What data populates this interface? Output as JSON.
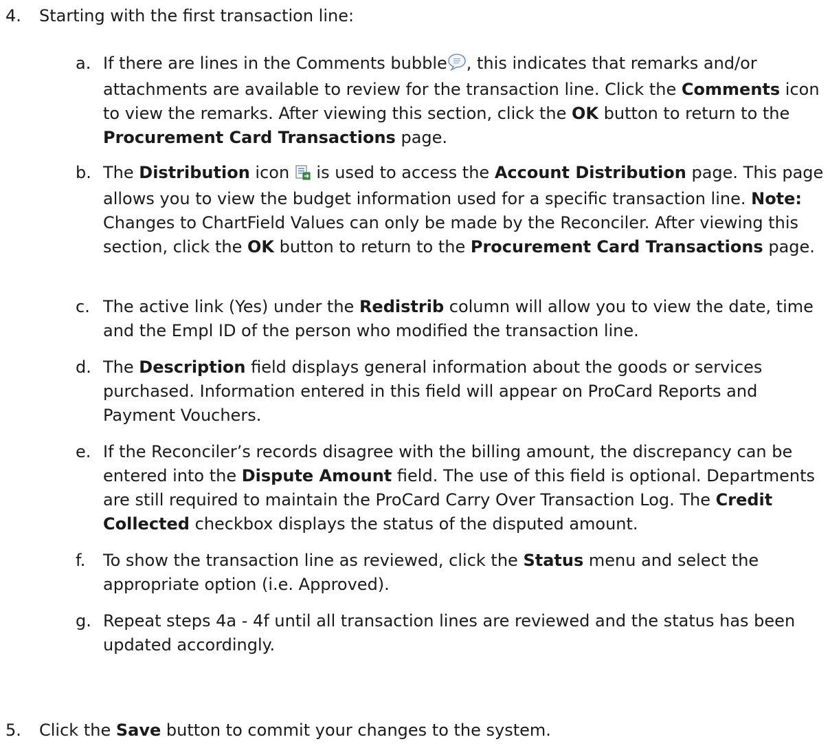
{
  "steps": [
    {
      "num": "4.",
      "text": "Starting with the first transaction line:"
    },
    {
      "num": "5.",
      "pre": "Click the ",
      "b1": "Save",
      "post": " button to commit your changes to the system."
    }
  ],
  "subs": {
    "a": {
      "letter": "a.",
      "t1": "If there are lines in the Comments bubble",
      "t2": ", this indicates that remarks and/or attachments are available to review for the transaction line.  Click the ",
      "b1": "Comments",
      "t3": " icon to view the remarks. After viewing this section, click the ",
      "b2": "OK",
      "t4": " button to return to the ",
      "b3": "Procurement Card Transactions",
      "t5": " page."
    },
    "b": {
      "letter": "b.",
      "t1": "The ",
      "b1": "Distribution",
      "t2": " icon ",
      "t3": " is used to access the ",
      "b2": "Account Distribution",
      "t4": " page. This page allows you to view the budget information used for a specific transaction line. ",
      "b3": "Note:",
      "t5": "  Changes to ChartField Values can only be made by the Reconciler. After viewing this section, click the ",
      "b4": "OK",
      "t6": " button to return to the ",
      "b5": "Procurement Card Transactions",
      "t7": " page."
    },
    "c": {
      "letter": "c.",
      "t1": "The active link (Yes) under the ",
      "b1": "Redistrib",
      "t2": " column will allow you to view the date, time and the Empl ID of the person who modified the transaction line."
    },
    "d": {
      "letter": "d.",
      "t1": "The ",
      "b1": "Description",
      "t2": " field displays general information about the goods or services purchased.  Information entered in this field will appear on ProCard Reports and Payment Vouchers."
    },
    "e": {
      "letter": "e.",
      "t1": "If the Reconciler’s records disagree with the billing amount, the discrepancy can be entered into the ",
      "b1": "Dispute Amount",
      "t2": " field. The use of this field is optional. Departments are still required to maintain the ProCard Carry Over Transaction Log. The ",
      "b2": "Credit Collected",
      "t3": " checkbox displays the status of the disputed amount."
    },
    "f": {
      "letter": "f.",
      "t1": "To show the transaction line as reviewed, click the ",
      "b1": "Status",
      "t2": " menu and select the appropriate option (i.e. Approved)."
    },
    "g": {
      "letter": "g.",
      "t1": "Repeat steps 4a - 4f until all transaction lines are reviewed and the status has been updated accordingly."
    }
  }
}
